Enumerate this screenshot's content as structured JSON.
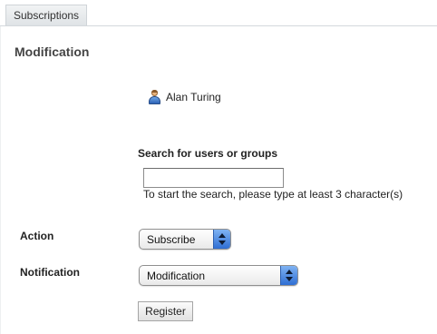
{
  "tabs": [
    {
      "label": "Subscriptions",
      "active": true
    }
  ],
  "page": {
    "title": "Modification"
  },
  "user": {
    "name": "Alan Turing",
    "icon": "user-icon"
  },
  "search": {
    "label": "Search for users or groups",
    "value": "",
    "placeholder": "",
    "hint": "To start the search, please type at least 3 character(s)"
  },
  "action": {
    "label": "Action",
    "selected": "Subscribe"
  },
  "notification": {
    "label": "Notification",
    "selected": "Modification"
  },
  "buttons": {
    "register": "Register"
  },
  "colors": {
    "select_accent": "#2f6ed3",
    "tab_bg": "#e4e7ea",
    "title_text": "#444444"
  }
}
